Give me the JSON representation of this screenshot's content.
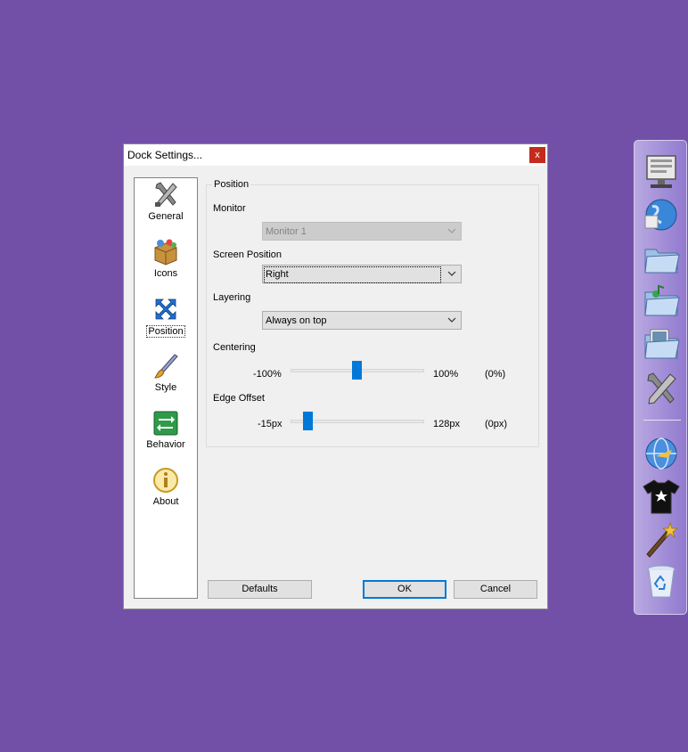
{
  "dialog": {
    "title": "Dock Settings...",
    "close_label": "x"
  },
  "nav": {
    "items": [
      {
        "label": "General",
        "icon": "tools-icon"
      },
      {
        "label": "Icons",
        "icon": "package-icon"
      },
      {
        "label": "Position",
        "icon": "arrows-icon"
      },
      {
        "label": "Style",
        "icon": "brush-icon"
      },
      {
        "label": "Behavior",
        "icon": "behavior-icon"
      },
      {
        "label": "About",
        "icon": "info-icon"
      }
    ],
    "active": "Position"
  },
  "position": {
    "group_label": "Position",
    "monitor_label": "Monitor",
    "monitor_value": "Monitor 1",
    "screen_position_label": "Screen Position",
    "screen_position_value": "Right",
    "layering_label": "Layering",
    "layering_value": "Always on top",
    "centering_label": "Centering",
    "centering_min": "-100%",
    "centering_max": "100%",
    "centering_readout": "(0%)",
    "centering_value": 0,
    "edge_offset_label": "Edge Offset",
    "edge_min": "-15px",
    "edge_max": "128px",
    "edge_readout": "(0px)",
    "edge_value": 0
  },
  "buttons": {
    "defaults": "Defaults",
    "ok": "OK",
    "cancel": "Cancel"
  },
  "dock": {
    "icons": [
      "monitor-icon",
      "globe-icon",
      "folder-icon",
      "music-folder-icon",
      "pictures-folder-icon",
      "tools-icon",
      "web-icon",
      "tshirt-icon",
      "wizard-icon",
      "recycle-bin-icon"
    ]
  },
  "colors": {
    "desktop": "#7350a8",
    "accent": "#0078d7",
    "close": "#c42b1c"
  }
}
